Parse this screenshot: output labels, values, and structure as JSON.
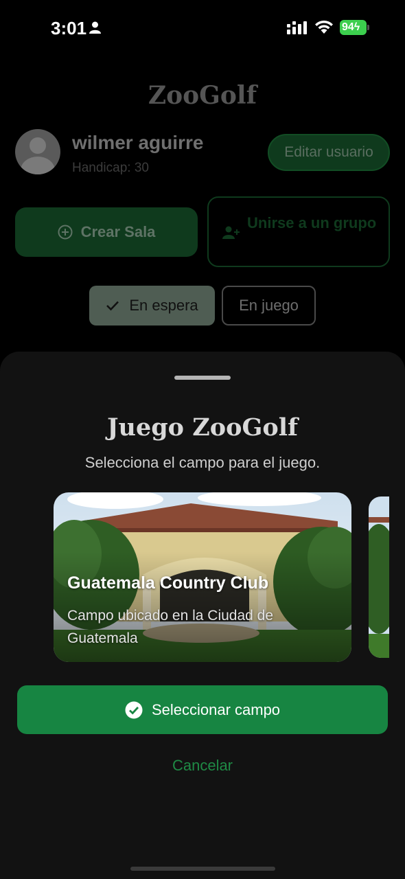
{
  "status_bar": {
    "time": "3:01",
    "battery": "94"
  },
  "header": {
    "brand": "ZooGolf"
  },
  "user": {
    "name": "wilmer aguirre",
    "handicap": "Handicap: 30",
    "edit_label": "Editar usuario"
  },
  "actions": {
    "create_room": "Crear Sala",
    "join_group": "Unirse a un grupo"
  },
  "filters": {
    "waiting": "En espera",
    "playing": "En juego",
    "selected": "En espera"
  },
  "sheet": {
    "title": "Juego ZooGolf",
    "subtitle": "Selecciona el campo para el juego.",
    "courses": [
      {
        "name": "Guatemala Country Club",
        "description": "Campo ubicado en la Ciudad de Guatemala"
      }
    ],
    "select_label": "Seleccionar campo",
    "cancel_label": "Cancelar"
  },
  "colors": {
    "accent": "#178542",
    "sheet_bg": "#121212",
    "dim_green": "#0f3a1d"
  }
}
